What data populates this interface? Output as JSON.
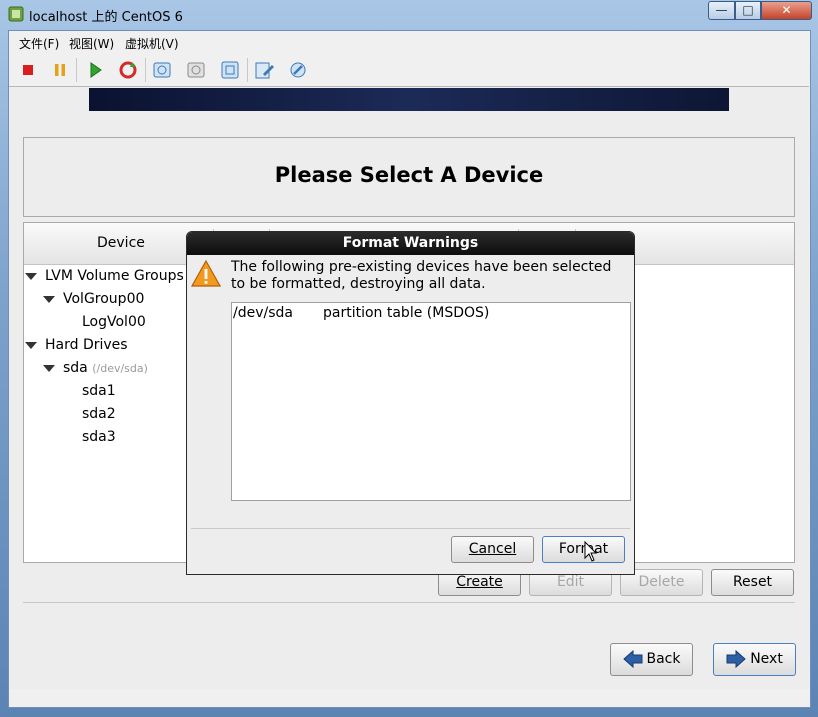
{
  "window": {
    "title": "localhost 上的 CentOS 6",
    "controls": {
      "minimize": "—",
      "maximize": "□",
      "close": "✕"
    }
  },
  "menu": [
    {
      "label": "文件(F)"
    },
    {
      "label": "视图(W)"
    },
    {
      "label": "虚拟机(V)"
    }
  ],
  "toolbar": {
    "icons": [
      "stop-icon",
      "pause-icon",
      "play-icon",
      "refresh-icon",
      "snapshot-icon",
      "snapshot-restore-icon",
      "snapshot-manager-icon",
      "edit-settings-icon",
      "tools-icon"
    ]
  },
  "installer": {
    "heading": "Please Select A Device",
    "column_device": "Device",
    "tree": {
      "lvm": "LVM Volume Groups",
      "volgroup": "VolGroup00",
      "logvol": "LogVol00",
      "hard_drives": "Hard Drives",
      "sda": "sda",
      "sda_path": "(/dev/sda)",
      "sda1": "sda1",
      "sda2": "sda2",
      "sda3": "sda3"
    },
    "buttons": {
      "create": "Create",
      "edit": "Edit",
      "delete": "Delete",
      "reset": "Reset",
      "back": "Back",
      "next": "Next"
    }
  },
  "dialog": {
    "title": "Format Warnings",
    "message": "The following pre-existing devices have been selected to be formatted, destroying all data.",
    "rows": [
      {
        "device": "/dev/sda",
        "desc": "partition table (MSDOS)"
      }
    ],
    "cancel": "Cancel",
    "format": "Format"
  }
}
